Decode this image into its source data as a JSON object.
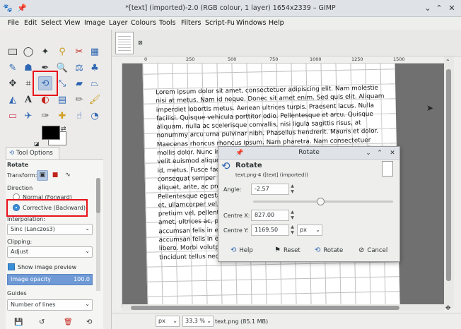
{
  "window": {
    "title": "*[text] (imported)-2.0 (RGB colour, 1 layer) 1654x2339 – GIMP"
  },
  "menu": [
    "File",
    "Edit",
    "Select",
    "View",
    "Image",
    "Layer",
    "Colours",
    "Tools",
    "Filters",
    "Script-Fu",
    "Windows",
    "Help"
  ],
  "tool_options": {
    "tab_label": "Tool Options",
    "tool_name": "Rotate",
    "transform_label": "Transform:",
    "direction_label": "Direction",
    "direction_normal": "Normal (Forward)",
    "direction_corrective": "Corrective (Backward)",
    "interpolation_label": "Interpolation:",
    "interpolation_value": "Sinc (Lanczos3)",
    "clipping_label": "Clipping:",
    "clipping_value": "Adjust",
    "show_preview_label": "Show image preview",
    "opacity_label": "Image opacity",
    "opacity_value": "100.0",
    "guides_label": "Guides",
    "guides_value": "Number of lines"
  },
  "status": {
    "unit": "px",
    "zoom": "33.3 %",
    "file_info": "text.png (85.1 MB)"
  },
  "document_text": "Lorem ipsum dolor sit amet, consectetuer adipiscing elit. Nam molestie nisi at metus. Nam id neque. Donec sit amet enim. Sed quis elit. Aliquam imperdiet lobortis metus. Aenean ultrices turpis. Praesent lacus. Nulla facilisi. Quisque vehicula porttitor odio. Pellentesque et arcu. Quisque aliquam, nulla ac scelerisque convallis, nisi ligula sagittis risus, at nonummy arcu urna pulvinar nibh. Phasellus hendrerit. Mauris et dolor. Maecenas rhoncus rhoncus ipsum. Nam pharetra. Nam consectetuer mollis dolor. Nunc in turpis ac lacus eleifend sagittis. Sed at turpis vitae velit euismod aliquet. Nullam blandit justo a metus. Morbi volutpat iaculis id, metus. Fusce facilisis eget, viverra et, venenatis sed pede volutpat consequat semper platea dictumst. A dignissim vestibulum. Praesent aliquet, ante, ac pretium torquent per conubia. Nam pharetra. Pellentesque egestas, velit odio, Etiam pede nunc, vestibulum vel, rutrum et, ullamcorper vel, neque. Phasellus diam eros, tristique sit amet, pretium vel, pellentesque ut, neque. Phasellus nisi metus, tempus sit amet, ultrices ac, porta nec, felis. Mauris et pede. Sed Curabitur accumsan felis in erat. Mauris et pede. Etiam cursus purus Curabitur accumsan felis in erat. Fusce consectetuer tellus ut nisl. Cras interdum libero. Morbi volutpat. Fusce consectetuer tellus ut nisl. Cras Curabitur tincidunt tellus nec purus. Nam elementum. Nulla facilisi. Morbi a mauris.",
  "rotate_dialog": {
    "window_title": "Rotate",
    "heading": "Rotate",
    "subheading": "text.png-4 ([text] (imported))",
    "angle_label": "Angle:",
    "angle_value": "-2.57",
    "centre_x_label": "Centre X:",
    "centre_x_value": "827.00",
    "centre_y_label": "Centre Y:",
    "centre_y_value": "1169.50",
    "unit": "px",
    "buttons": {
      "help": "Help",
      "reset": "Reset",
      "rotate": "Rotate",
      "cancel": "Cancel"
    }
  },
  "ruler_marks": [
    "0",
    "250",
    "500",
    "750",
    "1000",
    "1250",
    "1500"
  ],
  "icons": [
    "pin-icon",
    "close-icon",
    "minimize-icon",
    "maximize-icon",
    "move-icon",
    "rotate-tool-icon",
    "text-tool-icon",
    "paintbrush-icon",
    "help-icon",
    "reset-icon",
    "cancel-icon"
  ],
  "colors": {
    "highlight_red": "#e8121a",
    "selection_blue": "#3b8fd8",
    "canvas_bg": "#707070"
  }
}
